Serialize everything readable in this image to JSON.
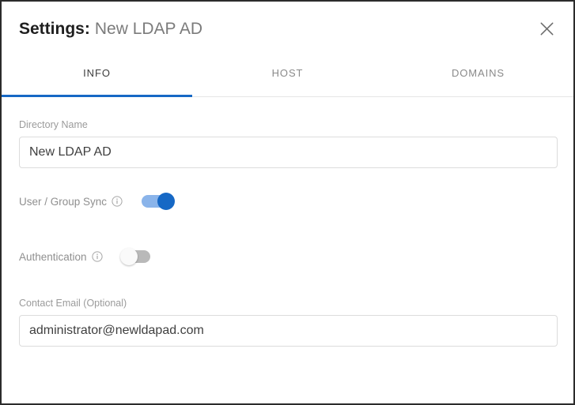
{
  "dialog": {
    "title_key": "Settings:",
    "title_value": "New LDAP AD",
    "close_icon": "close-icon"
  },
  "tabs": [
    {
      "label": "INFO",
      "active": true
    },
    {
      "label": "HOST",
      "active": false
    },
    {
      "label": "DOMAINS",
      "active": false
    }
  ],
  "form": {
    "directory_name": {
      "label": "Directory Name",
      "value": "New LDAP AD",
      "placeholder": "Directory Name"
    },
    "user_group_sync": {
      "label": "User / Group Sync",
      "info_icon": "info-icon",
      "state": "on",
      "state_label": "On"
    },
    "authentication": {
      "label": "Authentication",
      "info_icon": "info-icon",
      "state": "off",
      "state_label": "Off"
    },
    "contact_email": {
      "label": "Contact Email (Optional)",
      "value": "administrator@newldapad.com",
      "placeholder": "Contact Email"
    }
  },
  "colors": {
    "accent_blue": "#1668c5",
    "toggle_on_track": "#8ab4ea",
    "toggle_off_track": "#b9b9b9",
    "label_gray": "#9b9b9b",
    "title_dark": "#1f1f1f",
    "title_gray": "#7b7b7b",
    "border_dark": "#2b2b2b"
  }
}
